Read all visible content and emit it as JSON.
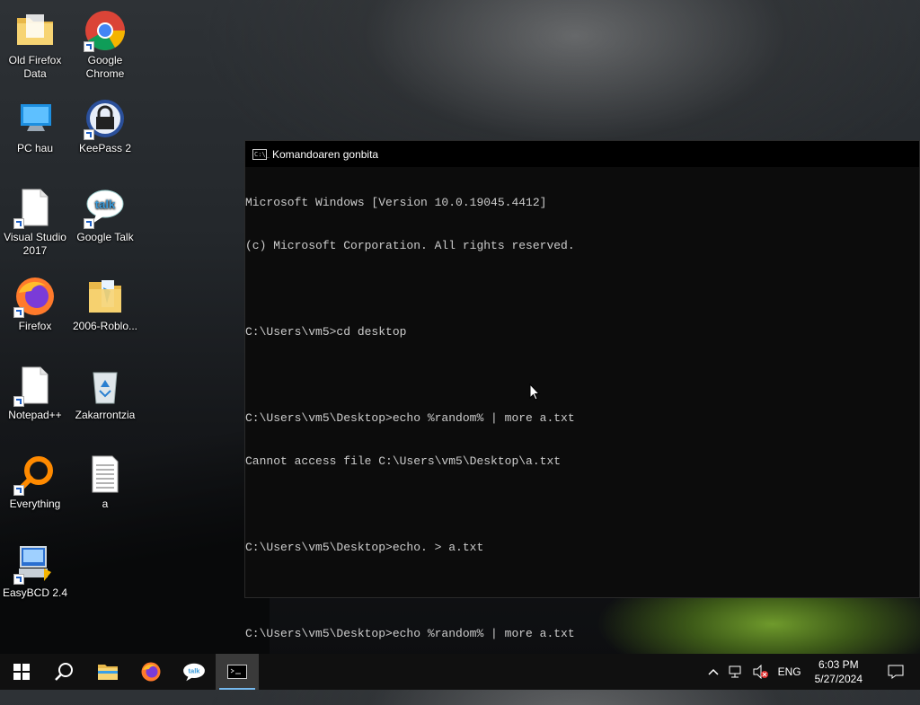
{
  "desktop": {
    "icons": [
      {
        "label": "Old Firefox\nData"
      },
      {
        "label": "Google\nChrome"
      },
      {
        "label": "PC hau"
      },
      {
        "label": "KeePass 2"
      },
      {
        "label": "Visual Studio\n2017"
      },
      {
        "label": "Google Talk"
      },
      {
        "label": "Firefox"
      },
      {
        "label": "2006-Roblo..."
      },
      {
        "label": "Notepad++"
      },
      {
        "label": "Zakarrontzia"
      },
      {
        "label": "Everything"
      },
      {
        "label": "a"
      },
      {
        "label": "EasyBCD 2.4"
      }
    ]
  },
  "console": {
    "title": "Komandoaren gonbita",
    "icon_text": "C:\\_",
    "lines": [
      "Microsoft Windows [Version 10.0.19045.4412]",
      "(c) Microsoft Corporation. All rights reserved.",
      "",
      "C:\\Users\\vm5>cd desktop",
      "",
      "C:\\Users\\vm5\\Desktop>echo %random% | more a.txt",
      "Cannot access file C:\\Users\\vm5\\Desktop\\a.txt",
      "",
      "C:\\Users\\vm5\\Desktop>echo. > a.txt",
      "",
      "C:\\Users\\vm5\\Desktop>echo %random% | more a.txt"
    ]
  },
  "taskbar": {
    "language": "ENG",
    "time": "6:03 PM",
    "date": "5/27/2024"
  },
  "colors": {
    "console_bg": "#0c0c0c",
    "console_text": "#cccccc",
    "taskbar_bg": "#101010",
    "accent": "#76b9ed"
  }
}
